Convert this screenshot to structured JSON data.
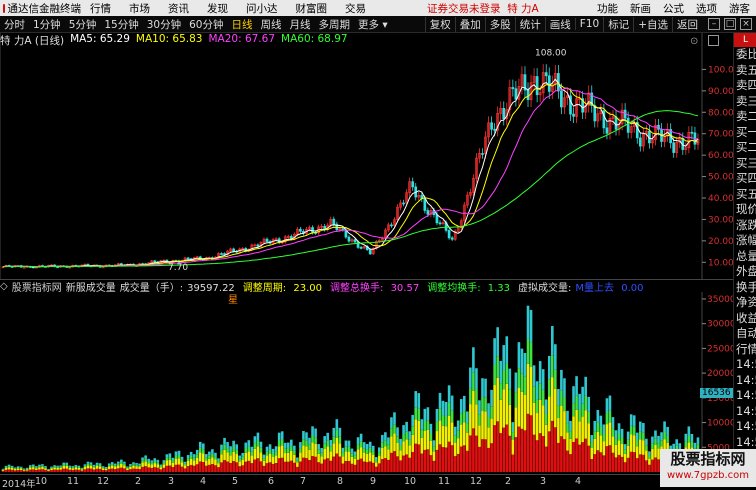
{
  "menubar": {
    "app_title": "通达信金融终端",
    "items": [
      "行情",
      "市场",
      "资讯",
      "发现",
      "问小达",
      "财富圈",
      "交易"
    ],
    "status": "证券交易未登录",
    "stock": "特 力A",
    "right": [
      "功能",
      "新画",
      "公式",
      "选项",
      "游客"
    ]
  },
  "periodbar": {
    "periods": [
      "分时",
      "1分钟",
      "5分钟",
      "15分钟",
      "30分钟",
      "60分钟",
      "日线",
      "周线",
      "月线",
      "多周期",
      "更多"
    ],
    "active": "日线",
    "tools": [
      "复权",
      "叠加",
      "多股",
      "统计",
      "画线",
      "F10",
      "标记",
      "+自选",
      "返回"
    ]
  },
  "ma": {
    "stock_label": "特 力A (日线)",
    "ma5": "MA5: 65.29",
    "ma10": "MA10: 65.83",
    "ma20": "MA20: 67.67",
    "ma60": "MA60: 68.97",
    "colors": {
      "ma5": "#ffffff",
      "ma10": "#ffff00",
      "ma20": "#ff40ff",
      "ma60": "#30ff30"
    }
  },
  "price_axis": {
    "labels": [
      "100.0",
      "90.00",
      "80.00",
      "70.00",
      "60.00",
      "50.00",
      "40.00",
      "30.00",
      "20.00",
      "10.00"
    ],
    "max_label": "108.00",
    "min_label": "7.70"
  },
  "volume_axis": {
    "labels": [
      "35000",
      "30000",
      "25000",
      "20000",
      "15000",
      "10000",
      "5000"
    ],
    "current": "16536"
  },
  "indicator": {
    "name": "股票指标网",
    "title": "新服成交量",
    "vol_label": "成交量（手）:",
    "vol_value": "39597.22",
    "period_label": "调整周期:",
    "period_value": "23.00",
    "sum_label": "调整总换手:",
    "sum_value": "30.57",
    "avg_label": "调整均换手:",
    "avg_value": "1.33",
    "virtual_label": "虚拟成交量:",
    "extra_label": "M量上去",
    "extra_value": "0.00"
  },
  "xaxis": [
    "2014年",
    "10",
    "11",
    "12",
    "2",
    "3",
    "4",
    "5",
    "6",
    "7",
    "8",
    "9",
    "10",
    "11",
    "12",
    "2",
    "3",
    "4"
  ],
  "side": {
    "badge": "L",
    "items": [
      "委比",
      "卖五",
      "卖四",
      "卖三",
      "卖二",
      "买一",
      "买二",
      "买三",
      "买四",
      "买五",
      "现价",
      "涨跌",
      "涨幅",
      "总量",
      "外盘",
      "换手",
      "净资",
      "收益",
      "自动",
      "行情",
      "14:5",
      "14:5",
      "14:5",
      "14:5",
      "14:5",
      "14:5",
      "14:5",
      "14:5"
    ]
  },
  "watermark": {
    "title": "股票指标网",
    "url": "www.7gpzb.com"
  },
  "marker": "星",
  "chart_data": [
    {
      "type": "candlestick",
      "title": "特 力A (日线)",
      "x": [
        "2014-09",
        "2014-10",
        "2014-11",
        "2014-12",
        "2015-02",
        "2015-03",
        "2015-04",
        "2015-05",
        "2015-06",
        "2015-07",
        "2015-08",
        "2015-09",
        "2015-10",
        "2015-11",
        "2015-12",
        "2016-02",
        "2016-03",
        "2016-04"
      ],
      "series": [
        {
          "name": "close",
          "values": [
            7.9,
            8.0,
            8.3,
            8.6,
            10.5,
            12.0,
            17.0,
            22.0,
            28.0,
            14.0,
            45.0,
            20.0,
            78.0,
            96.0,
            84.0,
            75.0,
            68.0,
            66.0
          ]
        }
      ],
      "ylim": [
        7.7,
        108.0
      ]
    },
    {
      "type": "bar",
      "title": "新服成交量",
      "x": [
        "2014-09",
        "2014-10",
        "2014-11",
        "2014-12",
        "2015-02",
        "2015-03",
        "2015-04",
        "2015-05",
        "2015-06",
        "2015-07",
        "2015-08",
        "2015-09",
        "2015-10",
        "2015-11",
        "2015-12",
        "2016-02",
        "2016-03",
        "2016-04"
      ],
      "series": [
        {
          "name": "成交量（手）",
          "values": [
            1200,
            1500,
            1800,
            2200,
            3500,
            5500,
            6800,
            7200,
            9500,
            6000,
            14000,
            16000,
            26000,
            30000,
            19000,
            12000,
            9000,
            7500
          ]
        }
      ],
      "ylim": [
        0,
        36000
      ]
    }
  ]
}
